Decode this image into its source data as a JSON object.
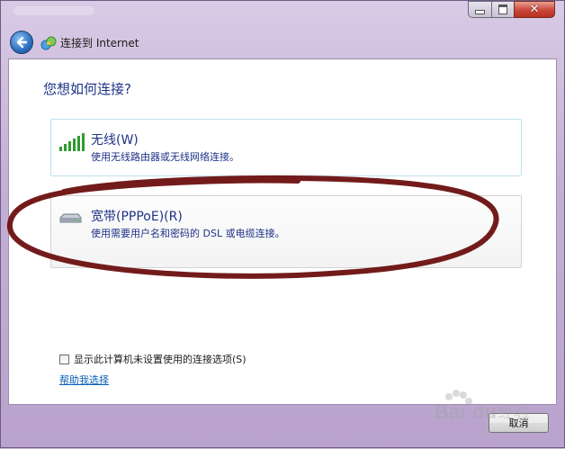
{
  "window": {
    "title": "连接到 Internet",
    "controls": {
      "minimize": "minimize-icon",
      "maximize": "maximize-icon",
      "close": "close-icon"
    }
  },
  "main": {
    "question": "您想如何连接?",
    "options": [
      {
        "title": "无线(W)",
        "description": "使用无线路由器或无线网络连接。",
        "icon": "wireless-signal-icon"
      },
      {
        "title": "宽带(PPPoE)(R)",
        "description": "使用需要用户名和密码的 DSL 或电缆连接。",
        "icon": "broadband-modem-icon"
      }
    ],
    "checkbox_label": "显示此计算机未设置使用的连接选项(S)",
    "help_link": "帮助我选择"
  },
  "footer": {
    "cancel_label": "取消"
  },
  "colors": {
    "accent_text": "#1e3287",
    "link": "#0a5fb4",
    "annotation_circle": "#6b0f0f"
  }
}
